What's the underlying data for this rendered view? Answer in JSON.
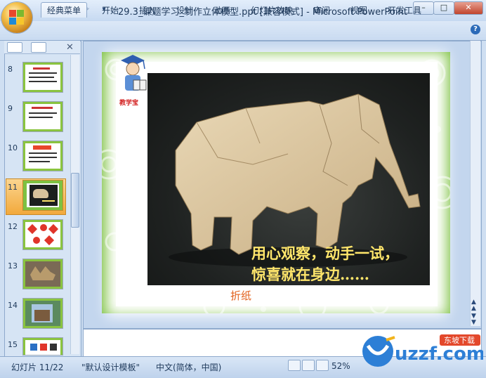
{
  "window": {
    "title": "29.3_课题学习_制作立体模型.ppt [兼容模式] - Microsoft PowerPoint",
    "min": "–",
    "max": "□",
    "close": "✕"
  },
  "qat": {
    "save_icon": "save-icon",
    "undo_icon": "undo-icon",
    "redo_icon": "redo-icon"
  },
  "ribbon": {
    "tabs": [
      "经典菜单",
      "开始",
      "插入",
      "设计",
      "动画",
      "幻灯片放映",
      "审阅",
      "视图",
      "开发工具"
    ],
    "help": "?"
  },
  "pane": {
    "close": "✕"
  },
  "thumbnails": [
    {
      "num": "8"
    },
    {
      "num": "9"
    },
    {
      "num": "10"
    },
    {
      "num": "11"
    },
    {
      "num": "12"
    },
    {
      "num": "13"
    },
    {
      "num": "14"
    },
    {
      "num": "15"
    }
  ],
  "slide": {
    "logo_text": "教学宝",
    "caption_line1": "用心观察，动手一试，",
    "caption_line2": "惊喜就在身边……",
    "caption_label": "折纸"
  },
  "status": {
    "slide_info": "幻灯片 11/22",
    "template": "\"默认设计模板\"",
    "language": "中文(简体，中国)",
    "zoom": "52%"
  },
  "watermark": {
    "text": "uzzf.com",
    "sub": "东坡下载"
  },
  "colors": {
    "slide_green": "#7dc142",
    "caption_yellow": "#ffe66b",
    "caption_orange": "#e2611d",
    "selected_thumb": "#f2a93c"
  }
}
